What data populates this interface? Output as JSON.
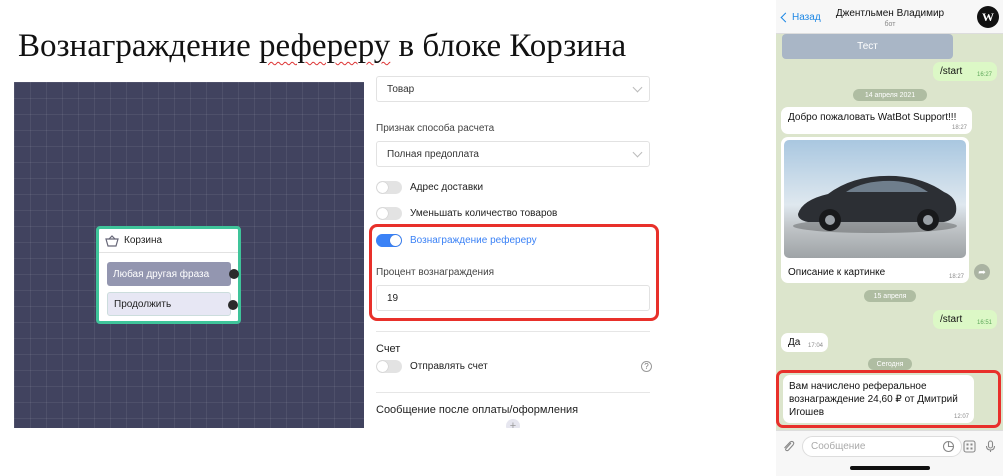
{
  "slide": {
    "title_before": "Вознаграждение ",
    "title_marked": "рефереру",
    "title_after": " в блоке Корзина"
  },
  "canvas": {
    "node_title": "Корзина",
    "buttons": [
      "Любая другая фраза",
      "Продолжить"
    ]
  },
  "panel": {
    "item_type_value": "Товар",
    "payment_method_label": "Признак способа расчета",
    "payment_method_value": "Полная предоплата",
    "toggles": {
      "delivery_address": {
        "label": "Адрес доставки",
        "on": false
      },
      "decrease_quantity": {
        "label": "Уменьшать количество товаров",
        "on": false
      },
      "referrer_reward": {
        "label": "Вознаграждение рефереру",
        "on": true
      }
    },
    "reward_percent_label": "Процент вознаграждения",
    "reward_percent_value": "19",
    "invoice_section_title": "Счет",
    "send_invoice_label": "Отправлять счет",
    "send_invoice_on": false,
    "help_glyph": "?",
    "after_payment_title": "Сообщение после оплаты/оформления",
    "add_glyph": "+"
  },
  "phone": {
    "back_label": "Назад",
    "chat_name": "Джентльмен Владимир",
    "chat_subtitle": "бот",
    "avatar_letter": "W",
    "keyboard_button": "Тест",
    "messages": [
      {
        "dir": "out",
        "text": "/start",
        "time": "16:27"
      },
      {
        "dir": "date",
        "text": "14 апреля 2021"
      },
      {
        "dir": "in",
        "text": "Добро пожаловать WatBot Support!!!",
        "time": "18:27"
      },
      {
        "dir": "in",
        "text": "Описание к картинке",
        "time": "18:27",
        "has_image": true
      },
      {
        "dir": "date",
        "text": "15 апреля"
      },
      {
        "dir": "out",
        "text": "/start",
        "time": "16:51"
      },
      {
        "dir": "in",
        "text": "Да",
        "time": "17:04"
      },
      {
        "dir": "date",
        "text": "Сегодня"
      },
      {
        "dir": "in",
        "text": "Вам начислено реферальное вознаграждение 24,60 ₽ от Дмитрий Игошев",
        "time": "12:07"
      }
    ],
    "input_placeholder": "Сообщение",
    "colors": {
      "accent": "#1e88e5",
      "highlight": "#e8302a",
      "node_border": "#3fc49a"
    }
  }
}
